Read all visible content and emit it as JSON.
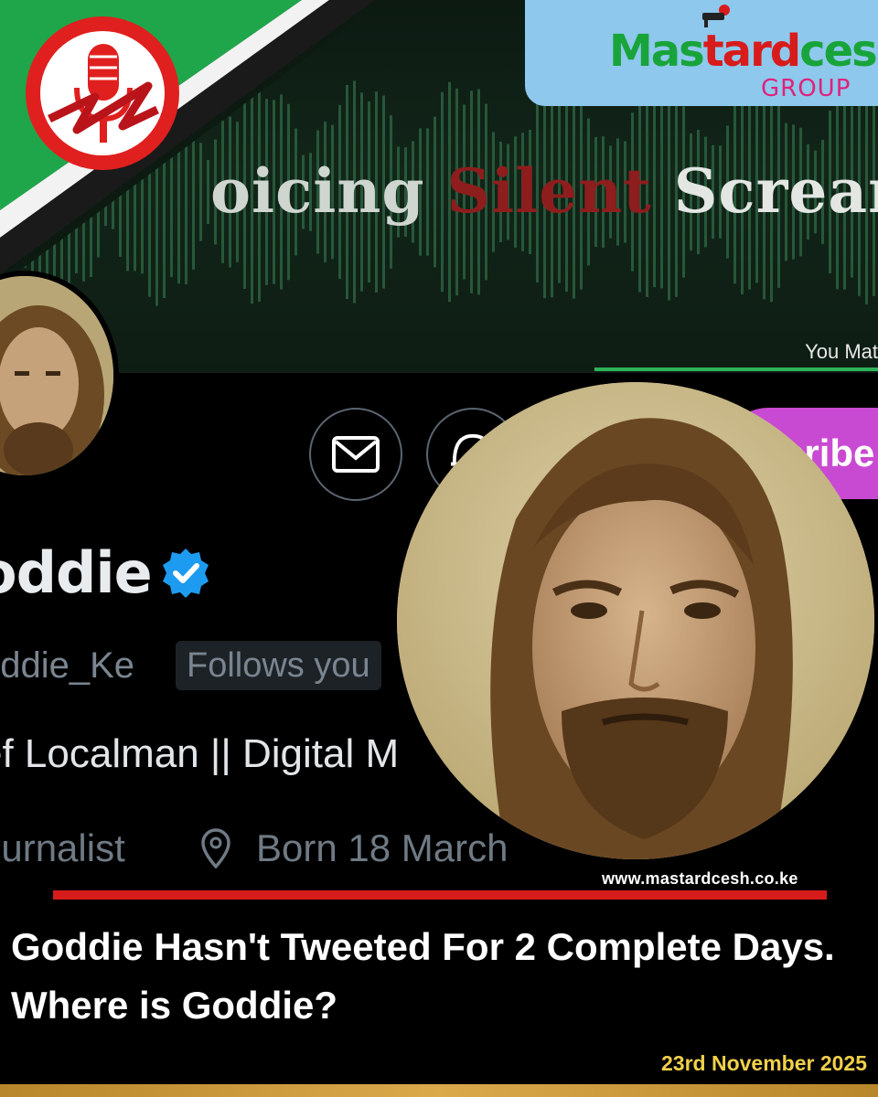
{
  "banner": {
    "title_part1": "oicing",
    "title_part2": "Silent",
    "title_part3": "Screams",
    "tagline": "You Mat"
  },
  "brand": {
    "name_part1": "Mas",
    "name_part2": "tard",
    "name_part3": "cesh",
    "sub": "GROUP"
  },
  "profile": {
    "display_name": "oddie",
    "handle": "oddie_Ke",
    "follows_badge": "Follows you",
    "bio": "ef Localman || Digital M",
    "job": "ournalist",
    "birthday": "Born 18 March",
    "subscribe_label": "cribe"
  },
  "caption": {
    "website": "www.mastardcesh.co.ke",
    "headline": "Goddie Hasn't Tweeted For 2 Complete Days. Where is Goddie?",
    "date": "23rd November 2025"
  },
  "colors": {
    "accent_green": "#2fb35a",
    "accent_red": "#d61b1b",
    "subscribe_purple": "#c94ad2",
    "verified_blue": "#1d9bf0",
    "date_yellow": "#f1d04a",
    "brand_box": "#8ec8ec"
  },
  "icons": [
    "mail-icon",
    "bell-icon",
    "verified-badge-icon",
    "location-pin-icon",
    "microphone-logo-icon"
  ]
}
